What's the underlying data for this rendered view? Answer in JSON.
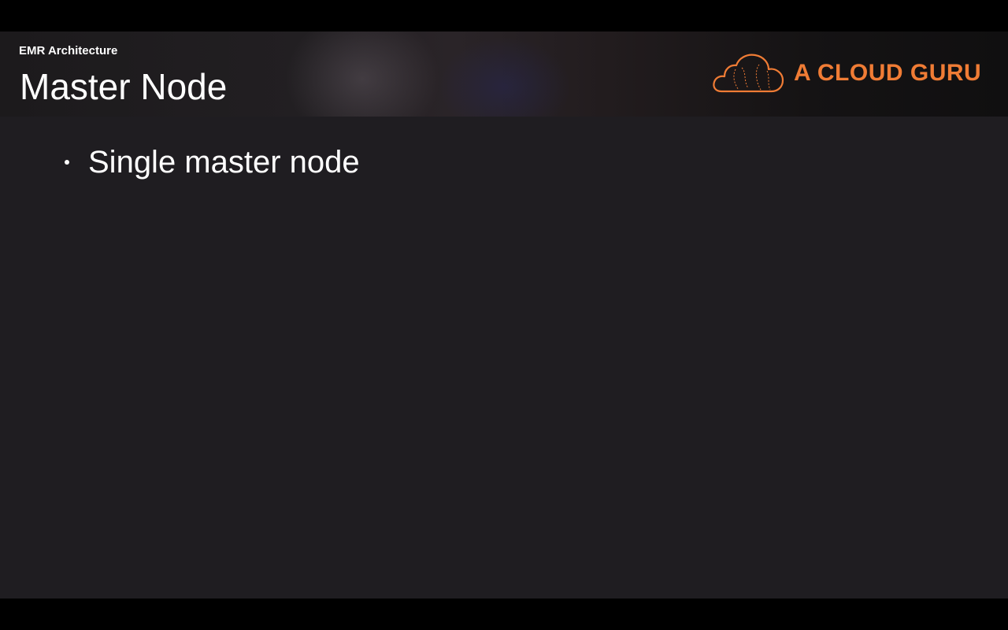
{
  "header": {
    "section_label": "EMR Architecture",
    "title": "Master Node",
    "logo_text": "A CLOUD GURU",
    "logo_icon": "cloud-icon"
  },
  "content": {
    "bullets": [
      {
        "text": "Single master node"
      }
    ]
  },
  "colors": {
    "slide_background": "#1f1d21",
    "letterbox": "#000000",
    "brand_orange": "#f07c35",
    "text": "#ffffff"
  }
}
